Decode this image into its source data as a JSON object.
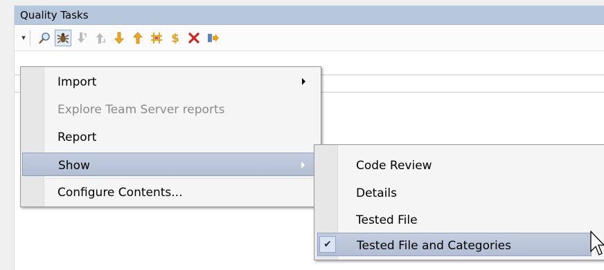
{
  "panel": {
    "title": "Quality Tasks"
  },
  "toolbar": {
    "dropdown_icon": "dropdown-arrow-icon",
    "buttons": [
      {
        "icon": "magnifier-icon",
        "active": false
      },
      {
        "icon": "bug-icon",
        "active": true
      },
      {
        "icon": "arrow-down-next-icon",
        "active": false
      },
      {
        "icon": "arrow-up-previous-icon",
        "active": false
      },
      {
        "icon": "arrow-down-icon",
        "active": false
      },
      {
        "icon": "arrow-up-icon",
        "active": false
      },
      {
        "icon": "grid-icon",
        "active": false
      },
      {
        "icon": "dollar-icon",
        "active": false
      },
      {
        "icon": "delete-x-icon",
        "active": false
      },
      {
        "icon": "export-arrows-icon",
        "active": false
      }
    ]
  },
  "menu": {
    "items": [
      {
        "label": "Import",
        "submenu": true,
        "disabled": false
      },
      {
        "label": "Explore Team Server reports",
        "submenu": false,
        "disabled": true
      },
      {
        "label": "Report",
        "submenu": false,
        "disabled": false
      },
      {
        "label": "Show",
        "submenu": true,
        "disabled": false,
        "highlighted": true
      },
      {
        "label": "Configure Contents...",
        "submenu": false,
        "disabled": false
      }
    ]
  },
  "submenu": {
    "items": [
      {
        "label": "Code Review",
        "checked": false
      },
      {
        "label": "Details",
        "checked": false
      },
      {
        "label": "Tested File",
        "checked": false
      },
      {
        "label": "Tested File and Categories",
        "checked": true,
        "highlighted": true
      }
    ],
    "check_glyph": "✔"
  },
  "colors": {
    "title_bar": "#b7c8dd",
    "highlight": "#b9c3d8",
    "menu_bg": "#f5f5f5",
    "gutter": "#e7e7e7"
  }
}
